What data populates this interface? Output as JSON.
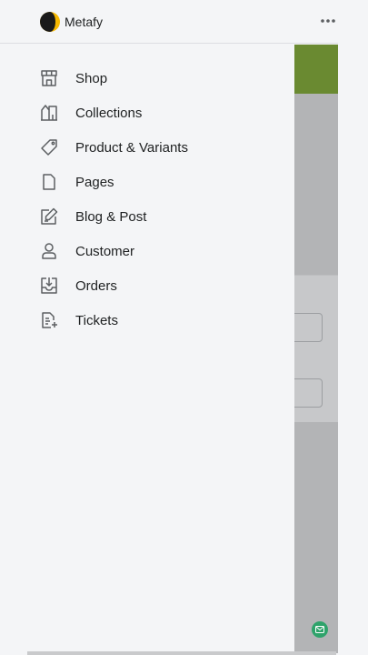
{
  "app": {
    "name": "Metafy",
    "logo_icon": "moon-logo-icon",
    "accent": "#f5b800"
  },
  "header": {
    "more_icon": "more-horizontal-icon"
  },
  "nav": {
    "items": [
      {
        "label": "Shop",
        "icon": "store-icon"
      },
      {
        "label": "Collections",
        "icon": "collections-icon"
      },
      {
        "label": "Product & Variants",
        "icon": "tag-icon"
      },
      {
        "label": "Pages",
        "icon": "page-icon"
      },
      {
        "label": "Blog & Post",
        "icon": "edit-icon"
      },
      {
        "label": "Customer",
        "icon": "user-icon"
      },
      {
        "label": "Orders",
        "icon": "orders-icon"
      },
      {
        "label": "Tickets",
        "icon": "tickets-icon"
      }
    ]
  },
  "colors": {
    "brand_green": "#6a8a31",
    "chat_green": "#2fa36b",
    "text": "#202223",
    "icon": "#5c5f62"
  }
}
